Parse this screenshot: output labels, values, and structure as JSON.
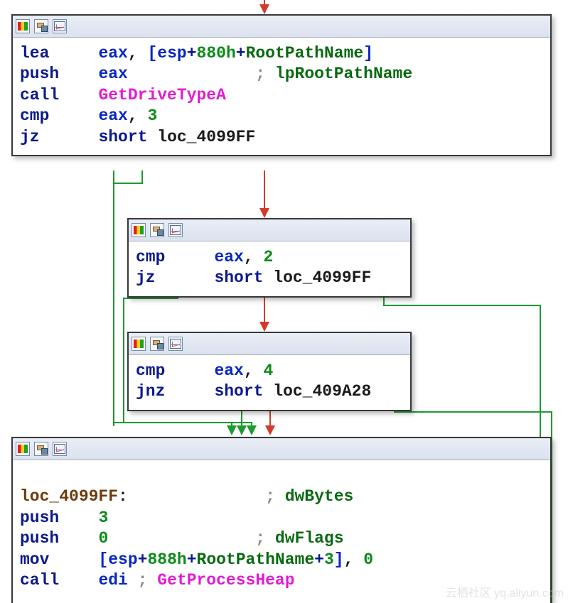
{
  "watermark": "云栖社区 yq.aliyun.com",
  "n1": {
    "l1": {
      "mn": "lea",
      "o1": "eax",
      "c1": ",",
      "b1": "[",
      "esp": "esp",
      "pl": "+",
      "h": "880h",
      "pl2": "+",
      "sym": "RootPathName",
      "b2": "]"
    },
    "l2": {
      "mn": "push",
      "o1": "eax",
      "semi": ";",
      "cmt": "lpRootPathName"
    },
    "l3": {
      "mn": "call",
      "fn": "GetDriveTypeA"
    },
    "l4": {
      "mn": "cmp",
      "o1": "eax",
      "c1": ",",
      "imm": "3"
    },
    "l5": {
      "mn": "jz",
      "kw": "short",
      "tgt": "loc_4099FF"
    }
  },
  "n2": {
    "l1": {
      "mn": "cmp",
      "o1": "eax",
      "c1": ",",
      "imm": "2"
    },
    "l2": {
      "mn": "jz",
      "kw": "short",
      "tgt": "loc_4099FF"
    }
  },
  "n3": {
    "l1": {
      "mn": "cmp",
      "o1": "eax",
      "c1": ",",
      "imm": "4"
    },
    "l2": {
      "mn": "jnz",
      "kw": "short",
      "tgt": "loc_409A28"
    }
  },
  "n4": {
    "l1": {
      "lbl": "loc_4099FF",
      "col": ":",
      "semi": ";",
      "cmt": "dwBytes"
    },
    "l2": {
      "mn": "push",
      "imm": "3"
    },
    "l3": {
      "mn": "push",
      "imm": "0",
      "semi": ";",
      "cmt": "dwFlags"
    },
    "l4": {
      "mn": "mov",
      "b1": "[",
      "esp": "esp",
      "pl": "+",
      "h": "888h",
      "pl2": "+",
      "sym": "RootPathName",
      "pl3": "+",
      "off": "3",
      "b2": "]",
      "c1": ",",
      "src": "0"
    },
    "l5": {
      "mn": "call",
      "reg": "edi",
      "semi": ";",
      "fn": "GetProcessHeap"
    }
  }
}
